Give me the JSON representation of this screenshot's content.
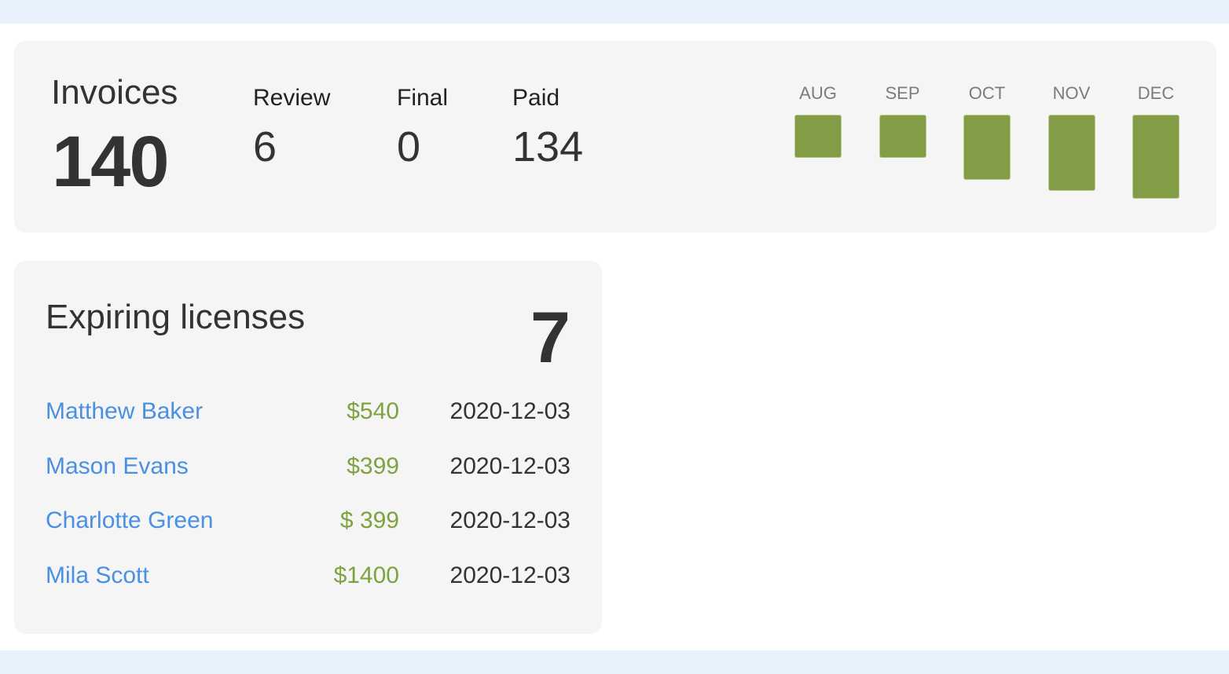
{
  "invoices": {
    "title": "Invoices",
    "total": "140",
    "stats": [
      {
        "label": "Review",
        "value": "6"
      },
      {
        "label": "Final",
        "value": "0"
      },
      {
        "label": "Paid",
        "value": "134"
      }
    ],
    "bar_color": "#829d45"
  },
  "chart_data": {
    "type": "bar",
    "title": "",
    "xlabel": "",
    "ylabel": "",
    "categories": [
      "AUG",
      "SEP",
      "OCT",
      "NOV",
      "DEC"
    ],
    "values": [
      55,
      55,
      83,
      97,
      107
    ],
    "ylim": [
      0,
      107
    ],
    "grid": false,
    "legend": "none",
    "note": "relative magnitudes only; no axis shown"
  },
  "licenses": {
    "title": "Expiring licenses",
    "count": "7",
    "rows": [
      {
        "name": "Matthew Baker",
        "amount": "$540",
        "date": "2020-12-03"
      },
      {
        "name": "Mason Evans",
        "amount": "$399",
        "date": "2020-12-03"
      },
      {
        "name": "Charlotte Green",
        "amount": "$ 399",
        "date": "2020-12-03"
      },
      {
        "name": "Mila Scott",
        "amount": "$1400",
        "date": "2020-12-03"
      }
    ],
    "colors": {
      "name": "#4a90e2",
      "amount": "#7ea23f"
    }
  }
}
